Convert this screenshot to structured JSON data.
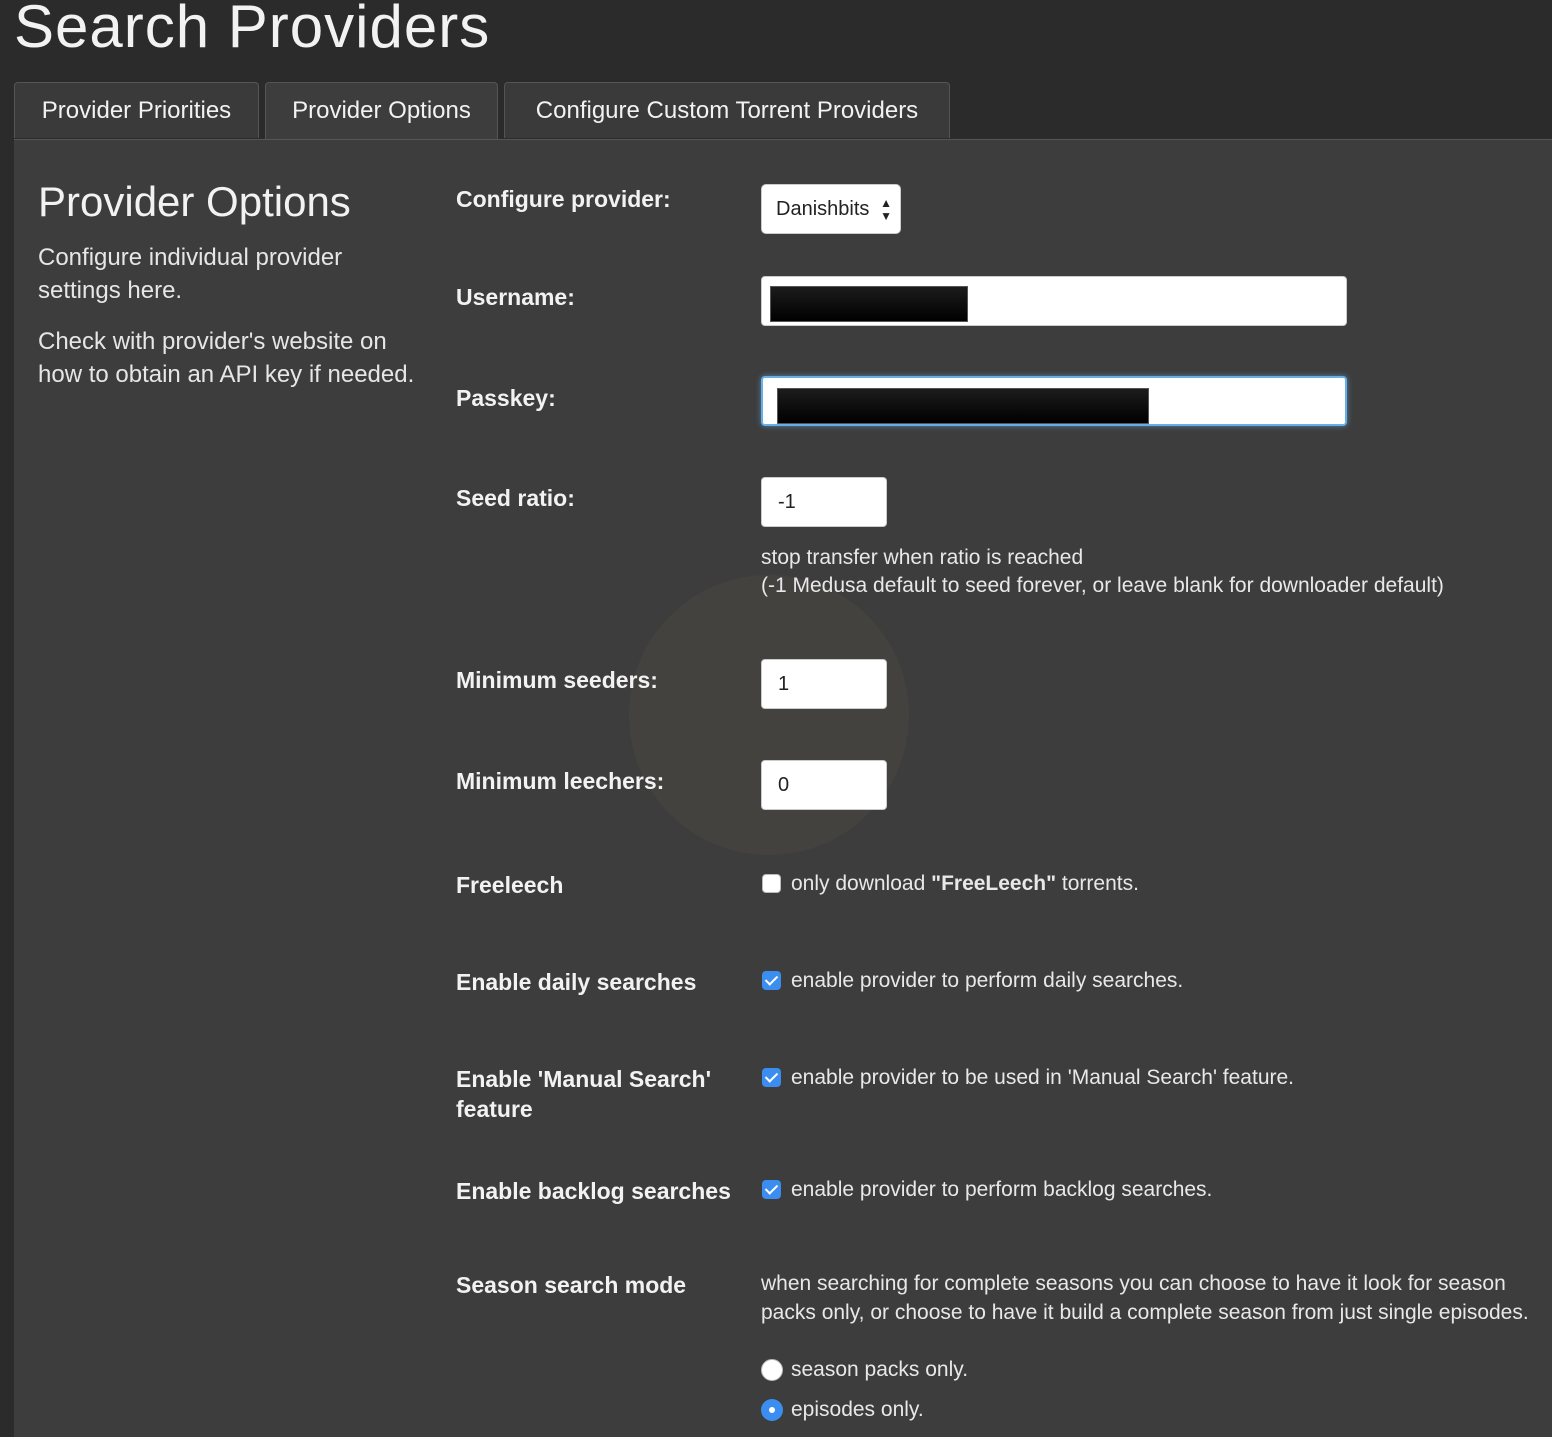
{
  "page": {
    "title": "Search Providers"
  },
  "tabs": [
    {
      "label": "Provider Priorities"
    },
    {
      "label": "Provider Options"
    },
    {
      "label": "Configure Custom Torrent Providers"
    }
  ],
  "sidebar": {
    "heading": "Provider Options",
    "text1": "Configure individual provider settings here.",
    "text2": "Check with provider's website on how to obtain an API key if needed."
  },
  "form": {
    "configure_provider": {
      "label": "Configure provider:",
      "value": "Danishbits"
    },
    "username": {
      "label": "Username:"
    },
    "passkey": {
      "label": "Passkey:"
    },
    "seed_ratio": {
      "label": "Seed ratio:",
      "value": "-1",
      "help1": "stop transfer when ratio is reached",
      "help2": "(-1 Medusa default to seed forever, or leave blank for downloader default)"
    },
    "min_seeders": {
      "label": "Minimum seeders:",
      "value": "1"
    },
    "min_leechers": {
      "label": "Minimum leechers:",
      "value": "0"
    },
    "freeleech": {
      "label": "Freeleech",
      "checked": false,
      "text_before": "only download ",
      "text_bold": "\"FreeLeech\"",
      "text_after": " torrents."
    },
    "daily": {
      "label": "Enable daily searches",
      "checked": true,
      "text": "enable provider to perform daily searches."
    },
    "manual": {
      "label_line1": "Enable 'Manual Search'",
      "label_line2": "feature",
      "checked": true,
      "text": "enable provider to be used in 'Manual Search' feature."
    },
    "backlog": {
      "label": "Enable backlog searches",
      "checked": true,
      "text": "enable provider to perform backlog searches."
    },
    "season_mode": {
      "label": "Season search mode",
      "help1": "when searching for complete seasons you can choose to have it look for season",
      "help2": "packs only, or choose to have it build a complete season from just single episodes.",
      "options": [
        {
          "label": "season packs only.",
          "selected": false
        },
        {
          "label": "episodes only.",
          "selected": true
        }
      ]
    }
  },
  "colors": {
    "background": "#2b2b2b",
    "panel": "#3d3d3d",
    "accent": "#3b8ef0"
  }
}
